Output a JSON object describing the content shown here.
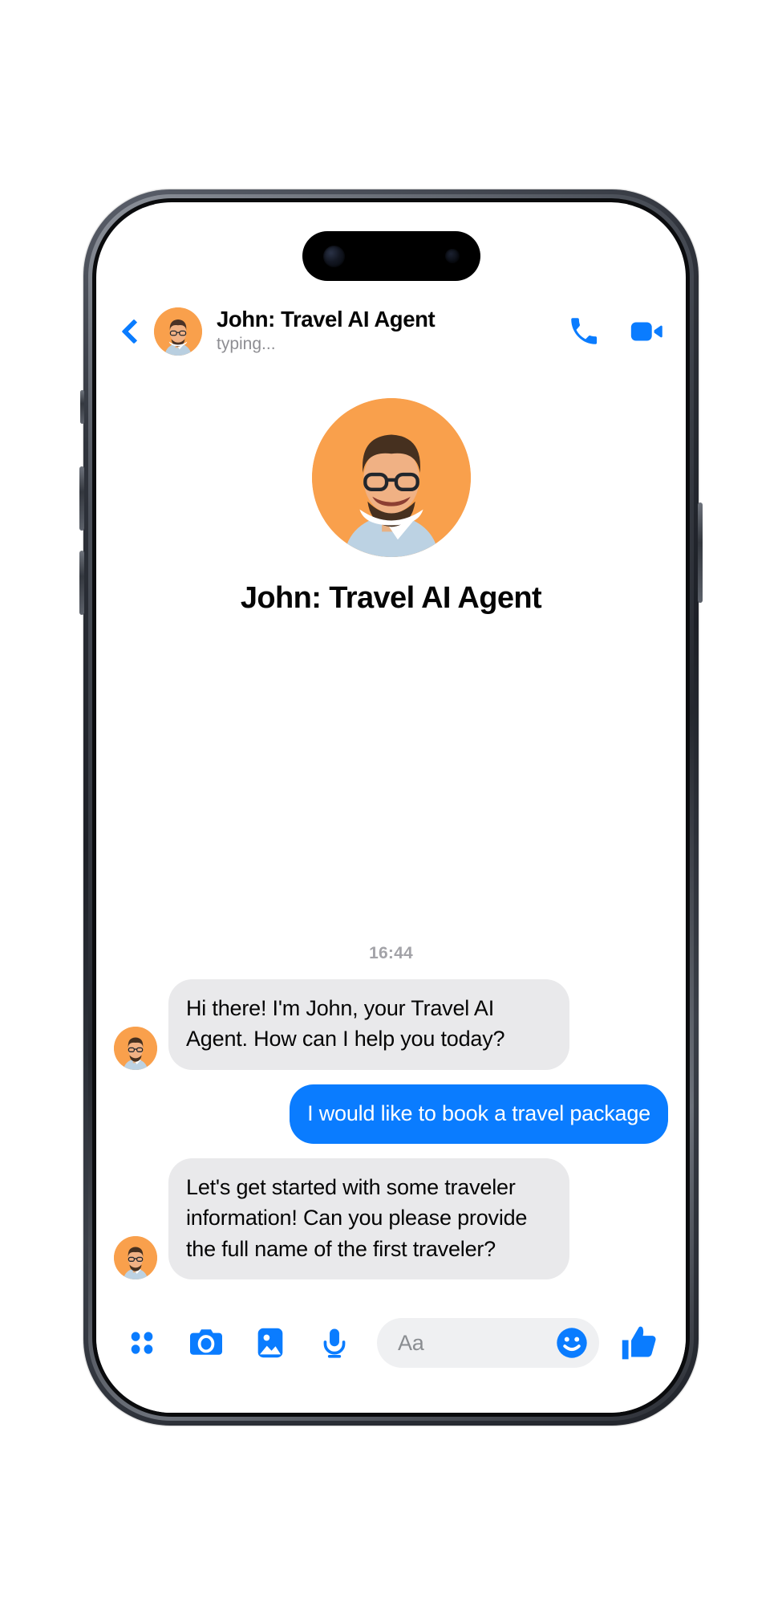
{
  "theme": {
    "accent_blue": "#0a7cff",
    "incoming_bubble": "#e9e9eb",
    "outgoing_bubble": "#0a7cff",
    "avatar_background": "#f9a04c",
    "muted_text": "#8e8e93",
    "input_field": "#eff0f2"
  },
  "header": {
    "back_icon": "back-chevron-icon",
    "avatar_icon": "contact-avatar",
    "title": "John: Travel AI Agent",
    "status": "typing...",
    "call_icon": "phone-call-icon",
    "video_icon": "video-call-icon"
  },
  "intro": {
    "avatar_icon": "profile-avatar-large",
    "name": "John: Travel AI Agent"
  },
  "conversation": {
    "timestamp": "16:44",
    "messages": [
      {
        "direction": "in",
        "sender": "John: Travel AI Agent",
        "text": "Hi there! I'm John, your Travel AI Agent. How can I help you today?",
        "has_avatar": true
      },
      {
        "direction": "out",
        "sender": "You",
        "text": "I would like to book a travel package",
        "has_avatar": false
      },
      {
        "direction": "in",
        "sender": "John: Travel AI Agent",
        "text": "Let's get started with some traveler information! Can you please provide the full name of the first traveler?",
        "has_avatar": true
      }
    ]
  },
  "input_bar": {
    "tools": [
      {
        "icon": "app-grid-icon",
        "label": "More apps"
      },
      {
        "icon": "camera-icon",
        "label": "Camera"
      },
      {
        "icon": "photo-gallery-icon",
        "label": "Photos"
      },
      {
        "icon": "microphone-icon",
        "label": "Voice message"
      }
    ],
    "placeholder": "Aa",
    "value": "",
    "emoji_icon": "smiley-face-icon",
    "like_icon": "thumbs-up-icon"
  }
}
